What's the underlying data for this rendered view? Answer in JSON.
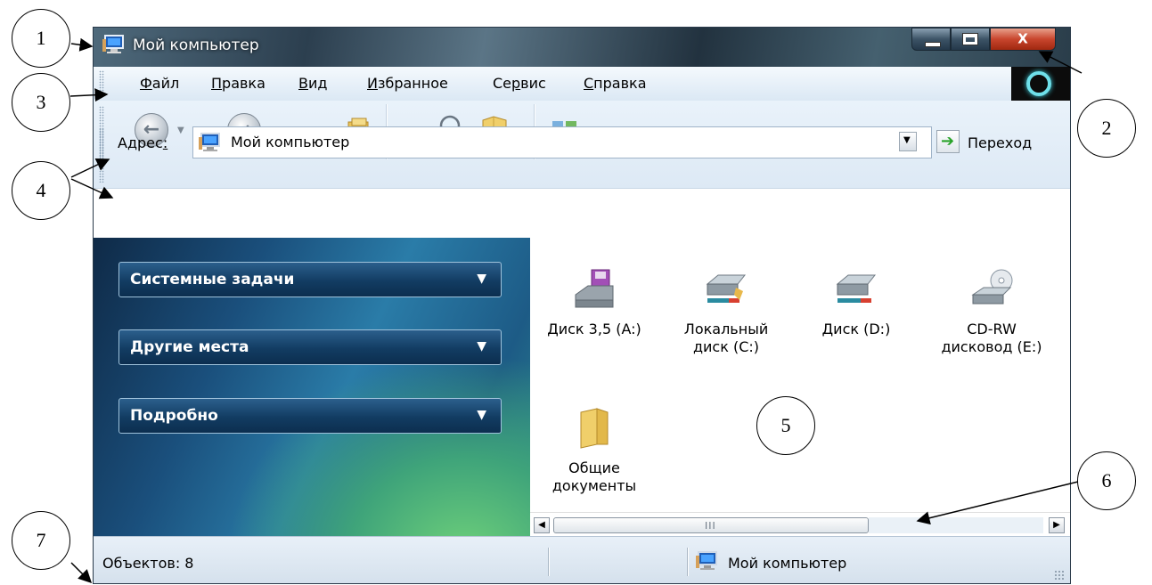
{
  "window": {
    "title": "Мой компьютер",
    "controls": {
      "close_glyph": "X"
    }
  },
  "menu": {
    "items": [
      {
        "pre": "",
        "ul": "Ф",
        "post": "айл"
      },
      {
        "pre": "",
        "ul": "П",
        "post": "равка"
      },
      {
        "pre": "",
        "ul": "В",
        "post": "ид"
      },
      {
        "pre": "",
        "ul": "И",
        "post": "збранное"
      },
      {
        "pre": "Се",
        "ul": "р",
        "post": "вис"
      },
      {
        "pre": "",
        "ul": "С",
        "post": "правка"
      }
    ]
  },
  "toolbar": {
    "icons": [
      "back-icon",
      "forward-icon",
      "folder-up-icon",
      "search-icon",
      "folders-icon",
      "views-icon"
    ]
  },
  "address": {
    "label_pre": "Адрес",
    "label_ul": ":",
    "value": "Мой компьютер",
    "go_label": "Переход"
  },
  "taskpane": {
    "sections": [
      "Системные задачи",
      "Другие места",
      "Подробно"
    ]
  },
  "content": {
    "items": [
      {
        "line1": "Диск 3,5 (A:)",
        "line2": "",
        "icon": "floppy-drive-icon"
      },
      {
        "line1": "Локальный",
        "line2": "диск (C:)",
        "icon": "hard-drive-icon"
      },
      {
        "line1": "Диск (D:)",
        "line2": "",
        "icon": "hard-drive-icon"
      },
      {
        "line1": "CD-RW",
        "line2": "дисковод (E:)",
        "icon": "cd-drive-icon"
      },
      {
        "line1": "Общие",
        "line2": "документы",
        "icon": "folder-icon"
      }
    ]
  },
  "scrollbar": {
    "grip": "III"
  },
  "status": {
    "objects": "Объектов: 8",
    "location": "Мой компьютер"
  },
  "callouts": [
    "1",
    "2",
    "3",
    "4",
    "5",
    "6",
    "7"
  ],
  "colors": {
    "titlebar": "#2c3f4f",
    "close_button": "#c8452d",
    "taskpane_blue": "#1a4f7c",
    "taskpane_green": "#6fd17a",
    "go_arrow": "#29a329"
  }
}
